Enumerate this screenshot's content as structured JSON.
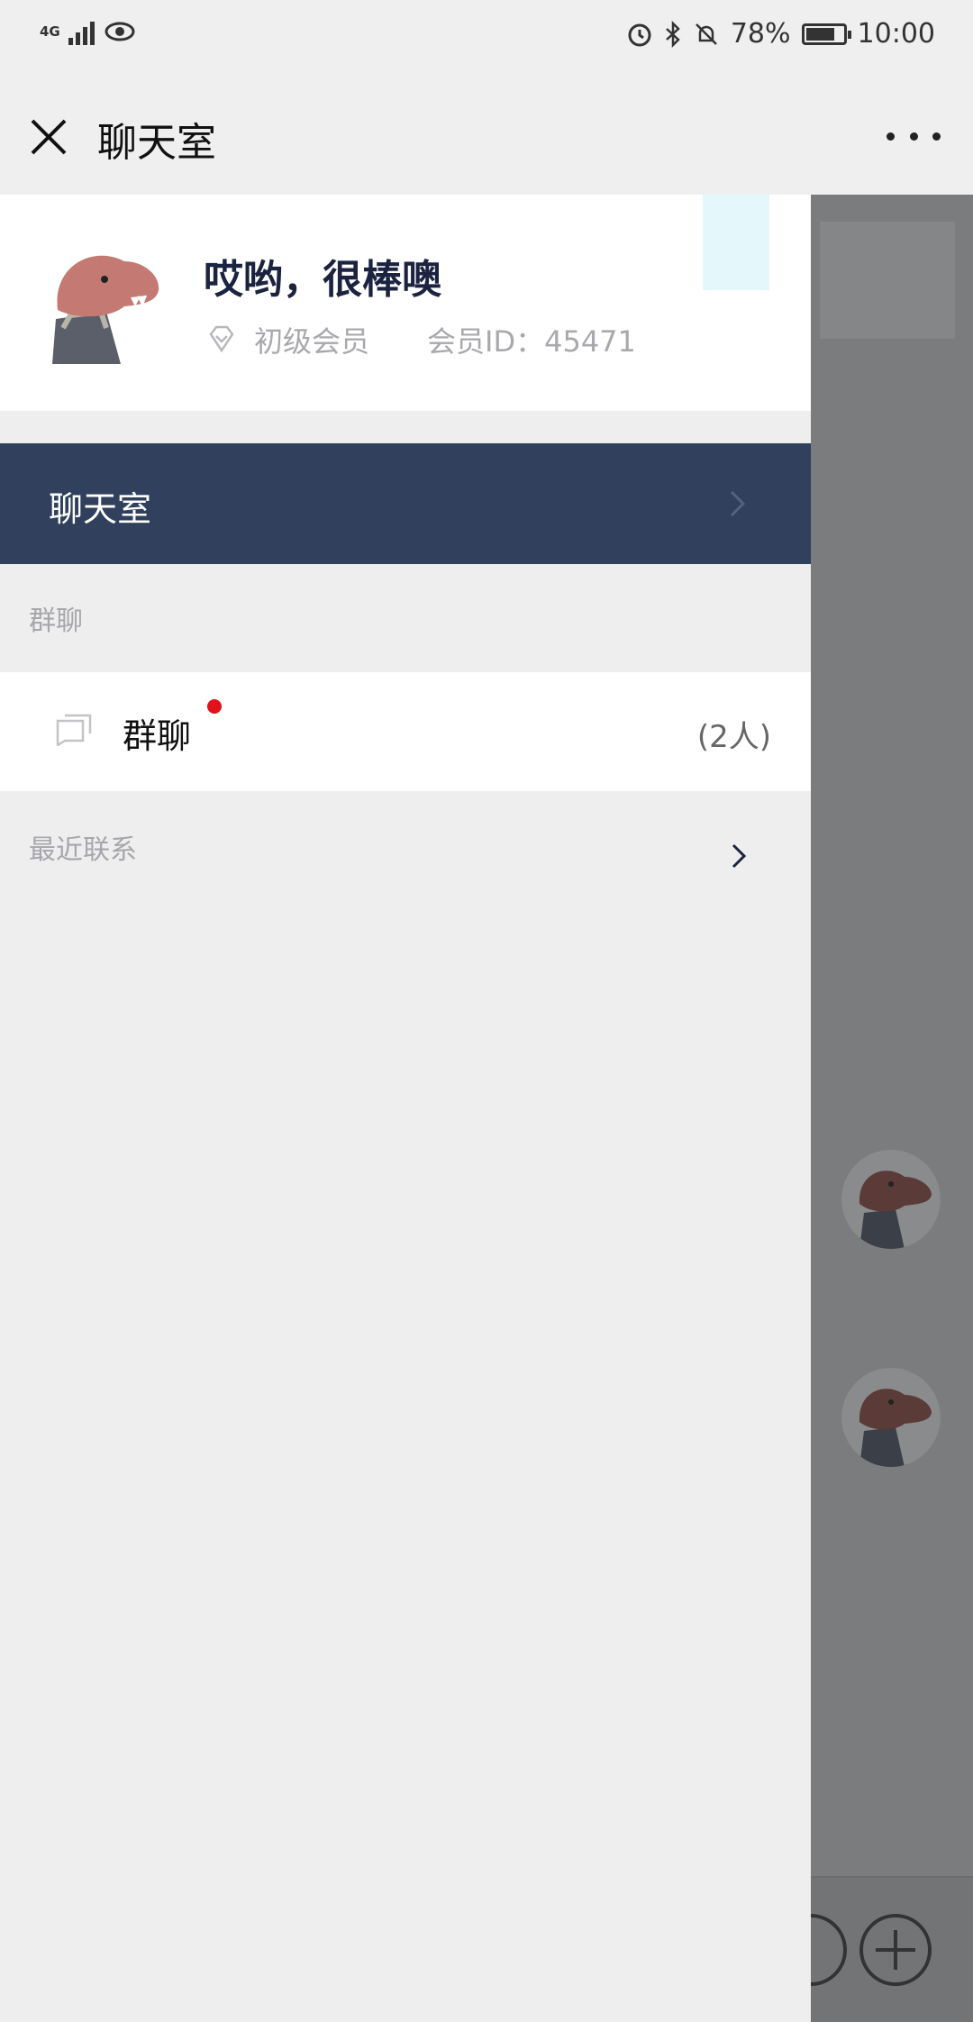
{
  "status_bar": {
    "network": "4G",
    "battery_percent": "78%",
    "battery_level": 0.78,
    "time": "10:00"
  },
  "header": {
    "title": "聊天室"
  },
  "profile": {
    "name": "哎哟，很棒噢",
    "member_level": "初级会员",
    "member_id": "会员ID：45471"
  },
  "menu": {
    "chatroom_label": "聊天室"
  },
  "group_section": {
    "header": "群聊",
    "items": [
      {
        "name": "群聊",
        "count": "(2人)",
        "unread": true
      }
    ]
  },
  "recent_section": {
    "header": "最近联系"
  },
  "colors": {
    "nav_active": "#31405c",
    "badge": "#e0121a",
    "background": "#efeff0"
  }
}
